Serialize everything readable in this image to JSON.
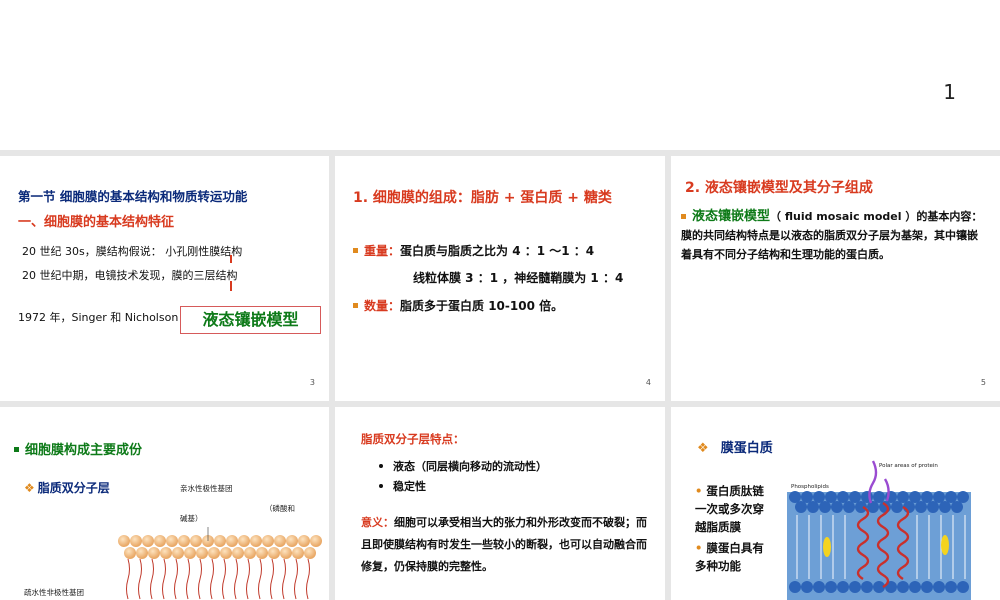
{
  "page_number": "1",
  "slides": [
    {
      "number": "3",
      "title_line1": "第一节 细胞膜的基本结构和物质转运功能",
      "title_line2": "一、细胞膜的基本结构特征",
      "line1": "20 世纪 30s，膜结构假说： 小孔刚性膜结构",
      "line2": "20 世纪中期，电镜技术发现，膜的三层结构",
      "line3": "1972 年，Singer 和 Nicholson",
      "model_box": "液态镶嵌模型"
    },
    {
      "number": "4",
      "heading": "1. 细胞膜的组成：脂肪 + 蛋白质 + 糖类",
      "weight_label": "重量：",
      "weight_text": "蛋白质与脂质之比为  4 ：1 ～1 ：4",
      "weight_text2": "线粒体膜 3 ：1 ，神经髓鞘膜为 1 ：4",
      "count_label": "数量：",
      "count_text": "脂质多于蛋白质 10-100 倍。"
    },
    {
      "number": "5",
      "heading": "2. 液态镶嵌模型及其分子组成",
      "term": "液态镶嵌模型",
      "paragraph": "（ fluid mosaic model ）的基本内容：   膜的共同结构特点是以液态的脂质双分子层为基架，其中镶嵌着具有不同分子结构和生理功能的蛋白质。"
    },
    {
      "heading": "细胞膜构成主要成份",
      "sub": "脂质双分子层",
      "label_hydrophilic": "亲水性极性基团",
      "label_paren": "（磷酸和",
      "label_base": "碱基）",
      "label_hydrophobic": "疏水性非极性基团"
    },
    {
      "heading": "脂质双分子层特点：",
      "items": [
        "液态（同层横向移动的流动性）",
        "稳定性"
      ],
      "meaning_label": "意义：",
      "meaning_text": "细胞可以承受相当大的张力和外形改变而不破裂；而且即使膜结构有时发生一些较小的断裂，也可以自动融合而修复，仍保持膜的完整性。"
    },
    {
      "heading": "膜蛋白质",
      "point1": "蛋白质肽链一次或多次穿越脂质膜",
      "point2": "膜蛋白具有多种功能",
      "label_phospholipids": "Phospholipids",
      "label_polar": "Polar areas of protein"
    }
  ]
}
